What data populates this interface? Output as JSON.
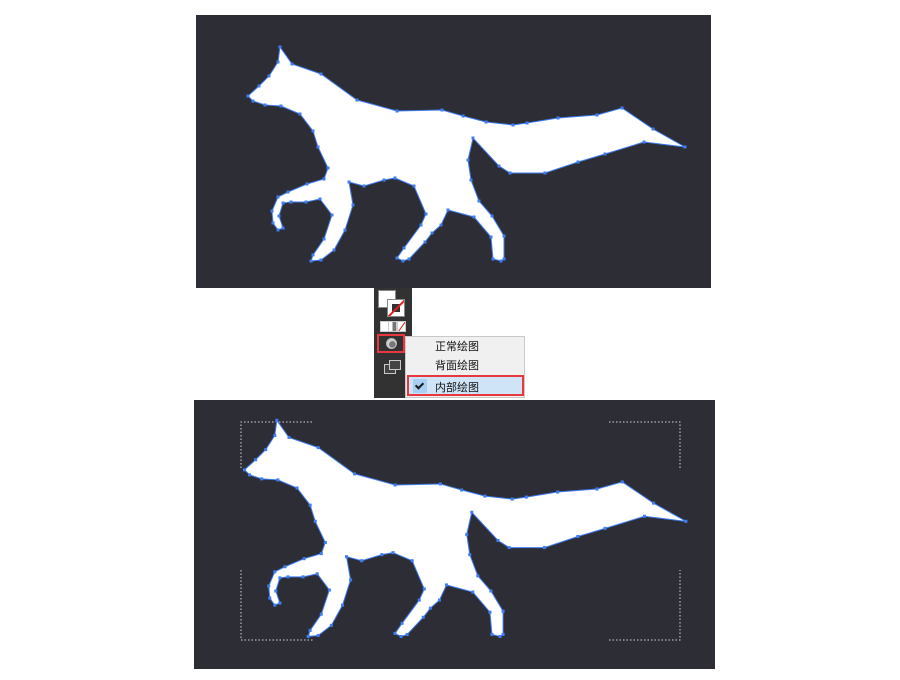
{
  "artwork": {
    "fill_color": "#ffffff",
    "canvas_color": "#2d2d35",
    "anchor_color": "#3f7df3"
  },
  "toolbar": {
    "fill_swatch_color": "#ffffff",
    "stroke_swatch_color": "#ffffff",
    "draw_mode_icon": "draw-mode-icon",
    "screen_mode_icon": "screen-mode-icon",
    "highlight_color": "#e8383d"
  },
  "draw_mode_menu": {
    "items": [
      {
        "label": "正常绘图",
        "checked": false
      },
      {
        "label": "背面绘图",
        "checked": false
      },
      {
        "label": "内部绘图",
        "checked": true
      }
    ]
  }
}
